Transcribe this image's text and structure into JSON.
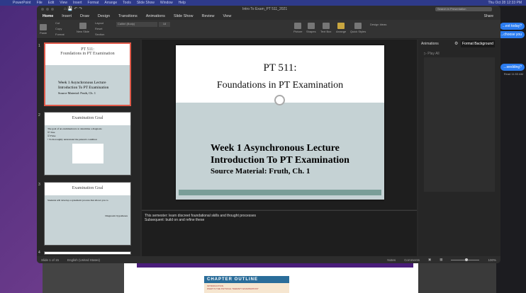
{
  "menubar": {
    "app": "PowerPoint",
    "items": [
      "File",
      "Edit",
      "View",
      "Insert",
      "Format",
      "Arrange",
      "Tools",
      "Slide Show",
      "Window",
      "Help"
    ],
    "clock": "Thu Oct 28 12:33 PM"
  },
  "window": {
    "title": "Intro To Exam_PT 511_2021",
    "search_placeholder": "Search in Presentation",
    "share": "Share"
  },
  "tabs": [
    "Home",
    "Insert",
    "Draw",
    "Design",
    "Transitions",
    "Animations",
    "Slide Show",
    "Review",
    "View"
  ],
  "ribbon": {
    "paste": "Paste",
    "cut": "Cut",
    "copy": "Copy",
    "format": "Format",
    "new_slide": "New Slide",
    "layout": "Layout",
    "reset": "Reset",
    "section": "Section",
    "font": "Calibri (Body)",
    "size": "18",
    "picture": "Picture",
    "shapes": "Shapes",
    "text_box": "Text Box",
    "arrange": "Arrange",
    "quick_styles": "Quick Styles",
    "design_ideas": "Design Ideas"
  },
  "thumbnails": [
    {
      "num": "1",
      "title": "PT 511:",
      "subtitle": "Foundations in PT Examination",
      "lines": [
        "Week 1 Asynchronous Lecture",
        "Introduction To PT Examination",
        "Source Material: Fruth, Ch. 1"
      ]
    },
    {
      "num": "2",
      "title": "Examination Goal",
      "lines": [
        "The goal of an examination is to determine a diagnosis",
        "☑ True",
        "☑ False",
        "• To thoroughly understand the patient's condition"
      ]
    },
    {
      "num": "3",
      "title": "Examination Goal",
      "lines": [
        "Students will develop a systematic process that allows you to",
        "Diagnostic hypotheses"
      ]
    },
    {
      "num": "4"
    }
  ],
  "slide": {
    "title": "PT 511:",
    "subtitle": "Foundations in PT Examination",
    "line1": "Week  1 Asynchronous Lecture",
    "line2": "Introduction To PT Examination",
    "line3": "Source Material:  Fruth, Ch. 1"
  },
  "notes": {
    "line1": "This semester:  learn discreet foundational skills and thought processes",
    "line2": "Subsequent: build on and refine these"
  },
  "right_pane": {
    "animations": "Animations",
    "format_background": "Format Background",
    "play_all": "▷ Play All"
  },
  "status": {
    "slide": "Slide 1 of 15",
    "language": "English (United States)",
    "notes": "Notes",
    "comments": "Comments",
    "zoom": "100%"
  },
  "messages": [
    "...ext today?",
    "...choose you",
    "...wedding?",
    "Read 11:53 AM"
  ],
  "document": {
    "heading": "CHAPTER OUTLINE",
    "lines": [
      "INTRODUCTION",
      "WHAT IS THE PHYSICAL THERAPY EXAMINATION?"
    ]
  }
}
